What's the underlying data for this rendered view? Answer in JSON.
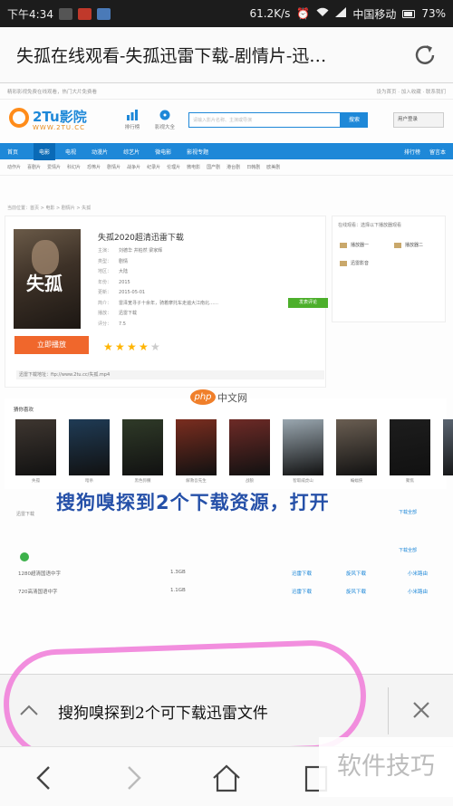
{
  "status_bar": {
    "time": "下午4:34",
    "net_speed": "61.2K/s",
    "carrier": "中国移动",
    "battery": "73%"
  },
  "browser": {
    "page_title": "失孤在线观看-失孤迅雷下载-剧情片-迅…"
  },
  "site": {
    "topline_left": "精彩影视免费在线观看，热门大片免费看",
    "topline_right": "设为首页 · 加入收藏 · 联系我们",
    "logo_text": "2Tu影院",
    "logo_sub": "WWW.2TU.CC",
    "header_icons": [
      "排行榜",
      "影视大全"
    ],
    "search_placeholder": "请输入影片名称、主演或导演",
    "search_button": "搜索",
    "login_label": "用户登录",
    "nav": [
      "首页",
      "电影",
      "电视",
      "动漫片",
      "综艺片",
      "微电影",
      "影视专题"
    ],
    "nav_active_index": 1,
    "nav_right": [
      "排行榜",
      "留言本"
    ],
    "subnav": [
      "动作片",
      "喜剧片",
      "爱情片",
      "科幻片",
      "恐怖片",
      "剧情片",
      "战争片",
      "纪录片",
      "伦理片",
      "微电影",
      "国产剧",
      "港台剧",
      "日韩剧",
      "欧美剧"
    ],
    "breadcrumb": "当前位置：首页 > 电影 > 剧情片 > 失孤"
  },
  "movie": {
    "title": "失孤2020超清迅雷下载",
    "poster_text": "失孤",
    "meta": [
      {
        "key": "主演：",
        "value": "刘德华 井柏然 梁家辉"
      },
      {
        "key": "类型：",
        "value": "剧情"
      },
      {
        "key": "地区：",
        "value": "大陆"
      },
      {
        "key": "年份：",
        "value": "2015"
      },
      {
        "key": "更新：",
        "value": "2015-05-01"
      },
      {
        "key": "简介：",
        "value": "雷泽宽寻子十余年，骑着摩托车走遍大江南北……"
      },
      {
        "key": "播放：",
        "value": "迅雷下载"
      },
      {
        "key": "评分：",
        "value": "7.5"
      }
    ],
    "play_button": "立即播放",
    "comment_button": "发表评论",
    "rating_stars": 4,
    "download_line": "迅雷下载地址：ftp://www.2tu.cc/失孤.mp4"
  },
  "sidebar": {
    "title": "在线观看：选择以下播放器观看",
    "items": [
      "播放器一",
      "播放器二",
      "迅雷影音"
    ]
  },
  "related": {
    "title": "猜你喜欢",
    "captions": [
      "失孤",
      "暗杀",
      "黑色弥撒",
      "解救吾先生",
      "战狼",
      "智取威虎山",
      "蝙蝠侠",
      "聚焦",
      "少年班"
    ],
    "colors": [
      "#3e3630",
      "#1f3b55",
      "#2f3a28",
      "#7a2d1f",
      "#6d2a26",
      "#9aa7b0",
      "#6a5e52",
      "#1d1d1d",
      "#5a6470"
    ]
  },
  "overlay_tip": "搜狗嗅探到2个下载资源，打开",
  "sources": {
    "heading": "迅雷下载",
    "link_more": "下载全部",
    "rows": [
      {
        "name": "1280超清国语中字",
        "size": "1.3GB",
        "a": "迅雷下载",
        "b": "旋风下载",
        "c": "小米路由"
      },
      {
        "name": "720高清国语中字",
        "size": "1.1GB",
        "a": "迅雷下载",
        "b": "旋风下载",
        "c": "小米路由"
      }
    ]
  },
  "download_bar": {
    "text": "搜狗嗅探到2个可下载迅雷文件"
  },
  "watermark": {
    "php": "php",
    "php_cn": "中文网",
    "bottom": "软件技巧"
  }
}
